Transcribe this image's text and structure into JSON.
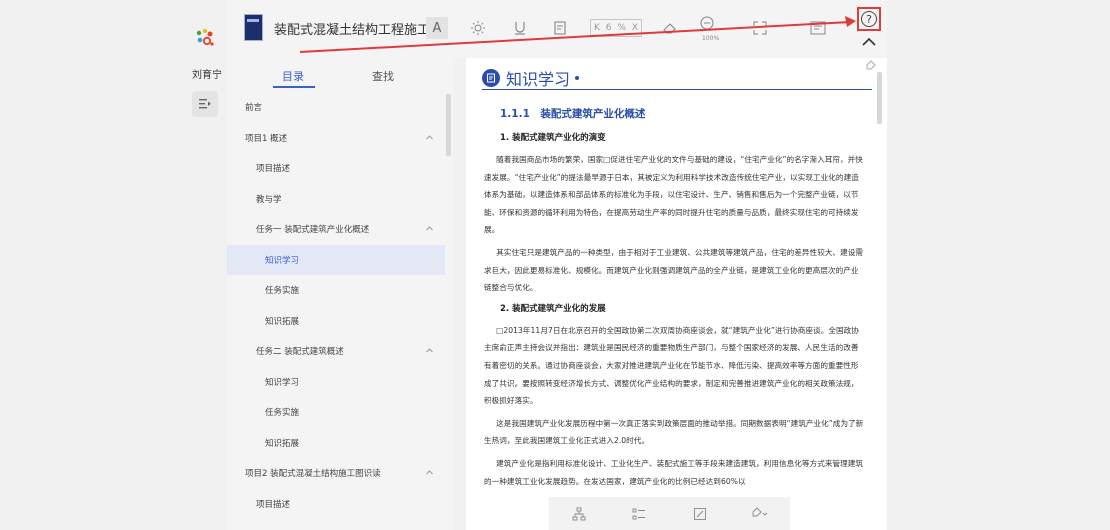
{
  "app": {
    "book_title": "装配式混凝土结构工程施工",
    "username": "刘育宁"
  },
  "toolbar": {
    "font_label": "A",
    "page_input_value": "6",
    "page_percent": "%",
    "zoom_label": "100%",
    "icons": [
      "brightness-icon",
      "underline-icon",
      "note-icon",
      "page-nav-icon",
      "eraser-icon",
      "zoom-icon",
      "fullscreen-icon",
      "reader-icon",
      "help-icon",
      "collapse-icon"
    ]
  },
  "toc": {
    "tabs": [
      "目录",
      "查找"
    ],
    "items": [
      {
        "label": "前言",
        "level": 0,
        "chevron": false,
        "active": false
      },
      {
        "label": "项目1 概述",
        "level": 0,
        "chevron": true,
        "active": false
      },
      {
        "label": "项目描述",
        "level": 1,
        "chevron": false,
        "active": false
      },
      {
        "label": "教与学",
        "level": 1,
        "chevron": false,
        "active": false
      },
      {
        "label": "任务一 装配式建筑产业化概述",
        "level": 1,
        "chevron": true,
        "active": false
      },
      {
        "label": "知识学习",
        "level": 2,
        "chevron": false,
        "active": true
      },
      {
        "label": "任务实施",
        "level": 2,
        "chevron": false,
        "active": false
      },
      {
        "label": "知识拓展",
        "level": 2,
        "chevron": false,
        "active": false
      },
      {
        "label": "任务二 装配式建筑概述",
        "level": 1,
        "chevron": true,
        "active": false
      },
      {
        "label": "知识学习",
        "level": 2,
        "chevron": false,
        "active": false
      },
      {
        "label": "任务实施",
        "level": 2,
        "chevron": false,
        "active": false
      },
      {
        "label": "知识拓展",
        "level": 2,
        "chevron": false,
        "active": false
      },
      {
        "label": "项目2 装配式混凝土结构施工图识读",
        "level": 0,
        "chevron": true,
        "active": false
      },
      {
        "label": "项目描述",
        "level": 1,
        "chevron": false,
        "active": false
      }
    ]
  },
  "content": {
    "banner": "知识学习",
    "section_title": "1.1.1　装配式建筑产业化概述",
    "subsections": [
      {
        "title": "1. 装配式建筑产业化的演变",
        "paragraphs": [
          "随着我国商品市场的繁荣，国家□促进住宅产业化的文件与基础的建设，“住宅产业化”的名字渐入耳帘，并快速发展。“住宅产业化”的提法最早源于日本，其被定义为利用科学技术改造传统住宅产业，以实现工业化的建造体系为基础，以建造体系和部品体系的标准化为手段，以住宅设计、生产、销售和售后为一个完整产业链，以节能、环保和资源的循环利用为特色，在提高劳动生产率的同时提升住宅的质量与品质，最终实现住宅的可持续发展。",
          "其实住宅只是建筑产品的一种类型，由于相对于工业建筑、公共建筑等建筑产品，住宅的差异性较大、建设需求巨大，因此更易标准化、规模化。而建筑产业化则强调建筑产品的全产业链，是建筑工业化的更高层次的产业链整合与优化。"
        ]
      },
      {
        "title": "2. 装配式建筑产业化的发展",
        "paragraphs": [
          "□2013年11月7日在北京召开的全国政协第二次双周协商座谈会，就“建筑产业化”进行协商座谈。全国政协主席俞正声主持会议并指出：建筑业是国民经济的重要物质生产部门，与整个国家经济的发展、人民生活的改善有着密切的关系。通过协商座谈会，大家对推进建筑产业化在节能节水、降低污染、提高效率等方面的重要性形成了共识。要按照转变经济增长方式、调整优化产业结构的要求，制定和完善推进建筑产业化的相关政策法规，积极抓好落实。",
          "这是我国建筑产业化发展历程中第一次真正落实到政策层面的推动举措。同期数据表明“建筑产业化”成为了新生热词，至此我国建筑工业化正式进入2.0时代。",
          "建筑产业化是指利用标准化设计、工业化生产、装配式施工等手段来建造建筑，利用信息化等方式来管理建筑的一种建筑工业化发展趋势。在发达国家，建筑产业化的比例已经达到60%以"
        ]
      }
    ]
  },
  "bottom_toolbar": {
    "icons": [
      "mindmap-icon",
      "list-icon",
      "edit-note-icon",
      "tag-icon"
    ]
  },
  "colors": {
    "accent": "#3a5fd0",
    "banner_blue": "#2a4ea9",
    "highlight_red": "#e03a3a"
  }
}
